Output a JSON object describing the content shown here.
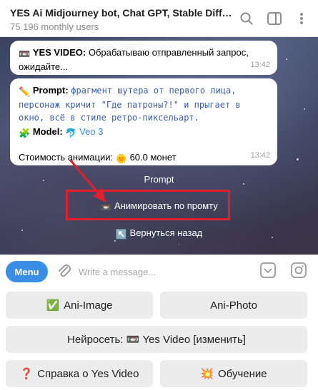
{
  "header": {
    "title": "YES Ai Midjourney bot, Chat GPT, Stable Diffusio...",
    "subtitle": "75 196 monthly users"
  },
  "messages": {
    "first": {
      "label": "YES VIDEO:",
      "text": " Обрабатываю отправленный запрос, ожидайте...",
      "time": "13:42"
    },
    "second": {
      "prompt_label": "Prompt:",
      "prompt_text": "фрагмент шутера от первого лица, персонаж кричит \"Где патроны?!\" и прыгает в окно, всё в стиле ретро-пиксельарт.",
      "model_label": "Model:",
      "model_value": "Veo 3",
      "cost_text": "Стоимость анимации:",
      "cost_value": "60.0 монет",
      "time": "13:42"
    }
  },
  "bot_label": "Prompt",
  "inline_buttons": {
    "animate": "Анимировать по промту",
    "back": "Вернуться назад"
  },
  "input": {
    "menu_label": "Menu",
    "placeholder": "Write a message..."
  },
  "keyboard": {
    "ani_image": "Ani-Image",
    "ani_photo": "Ani-Photo",
    "network": "Нейросеть: 📼 Yes Video [изменить]",
    "help": "Справка о Yes Video",
    "training": "Обучение"
  },
  "colors": {
    "accent": "#3a8ee6",
    "highlight": "#e0202a"
  }
}
